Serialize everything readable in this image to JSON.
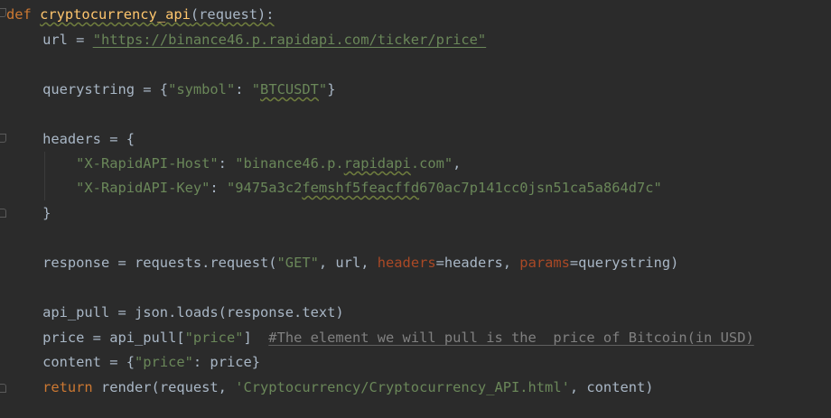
{
  "code": {
    "l1": {
      "kw": "def",
      "sp": " ",
      "fn": "cryptocurrency_api",
      "rest": "(request):"
    },
    "l2": {
      "indent": "    ",
      "lhs": "url = ",
      "str": "\"https://binance46.p.rapidapi.com/ticker/price\""
    },
    "l3": {
      "indent": "    ",
      "lhs": "querystring = {",
      "k": "\"symbol\"",
      "mid": ": ",
      "v_q1": "\"",
      "v": "BTCUSDT",
      "v_q2": "\"",
      "end": "}"
    },
    "l4": {
      "indent": "    ",
      "text": "headers = {"
    },
    "l5": {
      "indent": "        ",
      "k": "\"X-RapidAPI-Host\"",
      "mid": ": ",
      "v_a": "\"binance46.p.",
      "v_b": "rapidapi",
      "v_c": ".com\"",
      "end": ","
    },
    "l6": {
      "indent": "        ",
      "k": "\"X-RapidAPI-Key\"",
      "mid": ": ",
      "v_a": "\"9475a3c2",
      "v_b": "femshf5feacffd",
      "v_c": "670ac7p141cc0jsn51ca5a864d7c\""
    },
    "l7": {
      "indent": "    ",
      "text": "}"
    },
    "l8": {
      "indent": "    ",
      "a": "response = requests.request(",
      "s": "\"GET\"",
      "b": ", url, ",
      "p1": "headers",
      "c": "=headers, ",
      "p2": "params",
      "d": "=querystring)"
    },
    "l9": {
      "indent": "    ",
      "text": "api_pull = json.loads(response.text)"
    },
    "l10": {
      "indent": "    ",
      "a": "price = api_pull[",
      "s": "\"price\"",
      "b": "]  ",
      "cmt": "#The element we will pull is the  price of Bitcoin(in USD)"
    },
    "l11": {
      "indent": "    ",
      "a": "content = {",
      "s": "\"price\"",
      "b": ": price}"
    },
    "l12": {
      "indent": "    ",
      "kw": "return",
      "a": " render(request, ",
      "s": "'Cryptocurrency/Cryptocurrency_API.html'",
      "b": ", content)"
    }
  },
  "colors": {
    "background": "#2b2b2b",
    "keyword": "#cc7832",
    "function": "#ffc66d",
    "string": "#6a8759",
    "param": "#aa4926",
    "comment": "#808080",
    "plain": "#a9b7c6"
  }
}
